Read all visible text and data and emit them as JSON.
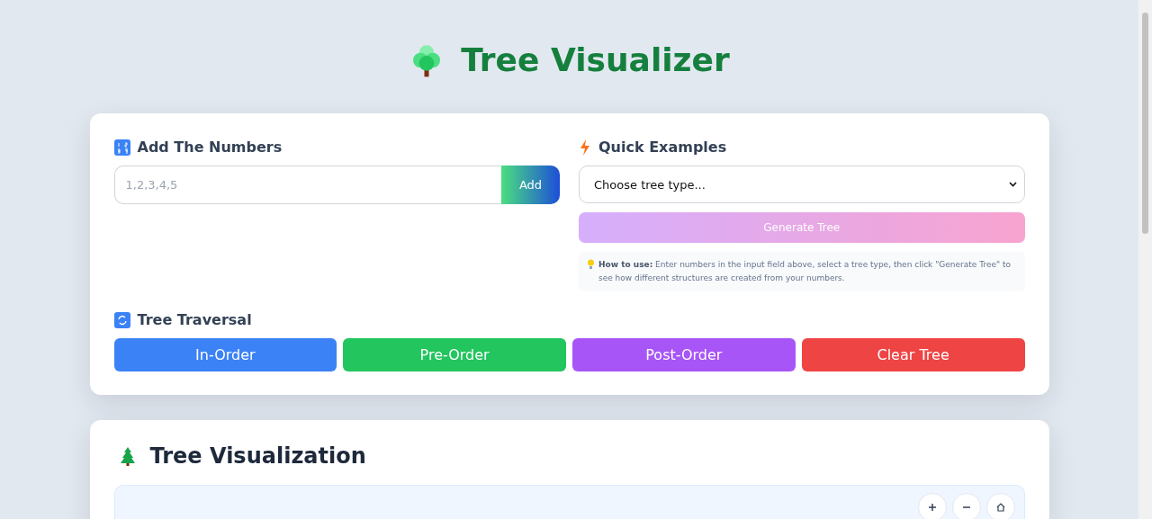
{
  "header": {
    "title": "Tree Visualizer"
  },
  "add_section": {
    "title": "Add The Numbers",
    "input": {
      "placeholder": "1,2,3,4,5"
    },
    "button": "Add"
  },
  "examples_section": {
    "title": "Quick Examples",
    "select": {
      "value": "Choose tree type..."
    },
    "generate_button": {
      "label": "Generate Tree",
      "disabled": true
    },
    "hint": "**How to use:** Enter numbers in the input field above, select a tree type, then click \"Generate Tree\" to see how different structures are created from your numbers."
  },
  "traversal_section": {
    "title": "Tree Traversal",
    "buttons": [
      {
        "label": "In-Order",
        "color": "#3b82f6"
      },
      {
        "label": "Pre-Order",
        "color": "#22c55e"
      },
      {
        "label": "Post-Order",
        "color": "#a855f7"
      },
      {
        "label": "Clear Tree",
        "color": "#ef4444"
      }
    ]
  },
  "visualization": {
    "title": "Tree Visualization",
    "controls": [
      {
        "kind": "zoom-in"
      },
      {
        "kind": "zoom-out"
      },
      {
        "kind": "reset"
      }
    ]
  }
}
